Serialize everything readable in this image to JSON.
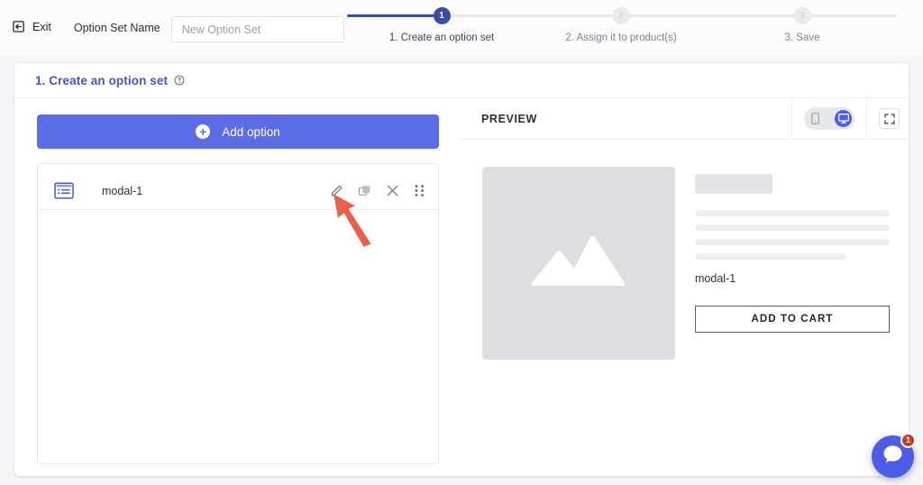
{
  "topbar": {
    "exit_label": "Exit",
    "option_set_name_label": "Option Set Name",
    "option_set_name_value": "",
    "option_set_name_placeholder": "New Option Set"
  },
  "stepper": {
    "steps": [
      {
        "number": "1",
        "label": "1. Create an option set",
        "state": "active"
      },
      {
        "number": "2",
        "label": "2. Assign it to product(s)",
        "state": "idle"
      },
      {
        "number": "3",
        "label": "3. Save",
        "state": "idle"
      }
    ]
  },
  "card": {
    "title": "1. Create an option set",
    "help_icon": "question-mark-circle-icon"
  },
  "left_pane": {
    "add_option_label": "Add option",
    "add_option_icon": "plus-circle-icon",
    "options": [
      {
        "icon": "modal-window-icon",
        "name": "modal-1",
        "actions": [
          "edit-pencil-icon",
          "duplicate-icon",
          "close-x-icon",
          "drag-handle-icon"
        ]
      }
    ]
  },
  "preview": {
    "title": "PREVIEW",
    "device_toggle": {
      "mobile_icon": "mobile-phone-icon",
      "desktop_icon": "desktop-monitor-icon",
      "selected": "desktop"
    },
    "expand_icon": "fullscreen-expand-icon",
    "image_placeholder_icon": "image-mountain-icon",
    "skeleton_lines": [
      100,
      100,
      100,
      78
    ],
    "product_option_name": "modal-1",
    "add_to_cart_label": "ADD TO CART"
  },
  "chat": {
    "icon": "chat-bubble-icon",
    "badge_count": "1"
  },
  "colors": {
    "brand_blue": "#5c6be8",
    "stepper_active": "#3b4ba8",
    "card_title": "#4553c4",
    "page_bg": "#f4f5f7",
    "arrow_red": "#e8604c",
    "badge_red": "#c9372c"
  }
}
